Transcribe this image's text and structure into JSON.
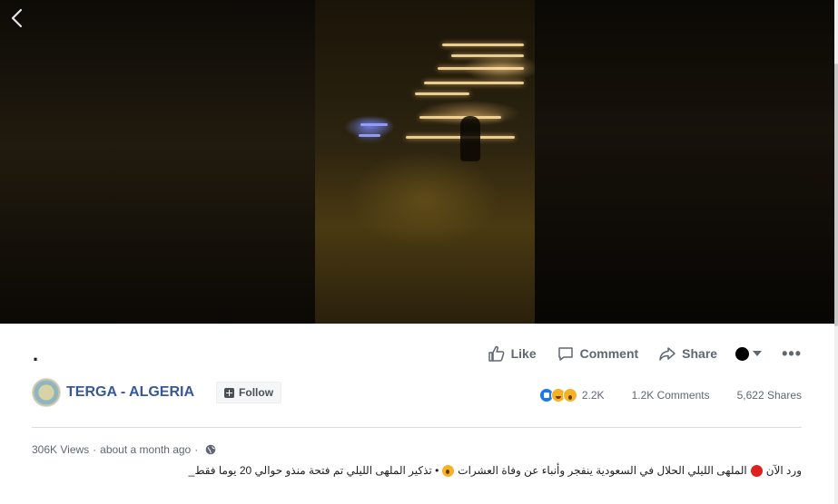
{
  "post": {
    "title": "."
  },
  "actions": {
    "like": "Like",
    "comment": "Comment",
    "share": "Share"
  },
  "page": {
    "name": "TERGA - ALGERIA",
    "follow_label": "Follow"
  },
  "stats": {
    "reactions": "2.2K",
    "comments": "1.2K Comments",
    "shares": "5,622 Shares"
  },
  "meta": {
    "views": "306K Views",
    "time": "about a month ago",
    "separator": "·"
  },
  "description": {
    "part1": "ورد الآن",
    "part2": "الملهى الليلي الحلال في السعودية ينفجر وأنباء عن وفاة العشرات",
    "part3": "• تذكير الملهى الليلي تم فتحة منذو حوالي 20 يوما فقط_"
  },
  "icons": {
    "back": "chevron-left-icon",
    "like": "thumbs-up-icon",
    "comment": "speech-bubble-icon",
    "share": "share-arrow-icon",
    "globe": "globe-icon",
    "more": "more-horizontal-icon"
  },
  "colors": {
    "link_blue": "#385898",
    "text_secondary": "#606770",
    "like_blue": "#1877f2"
  }
}
